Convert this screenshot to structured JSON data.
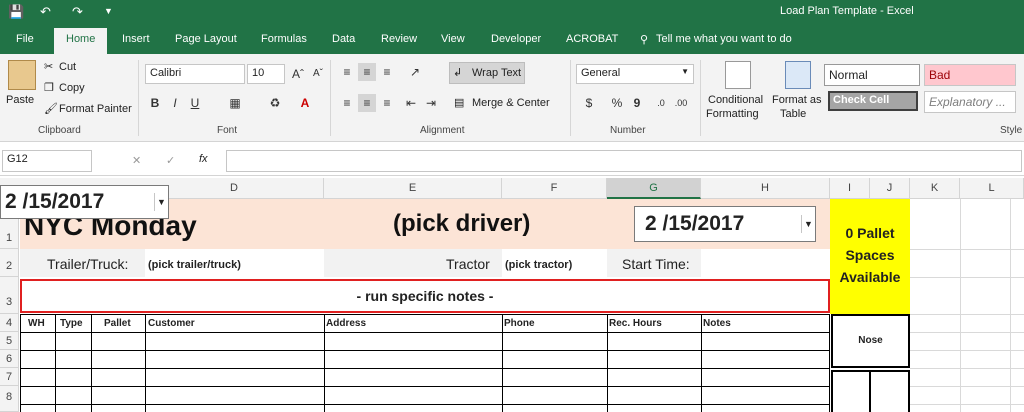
{
  "window": {
    "title": "Load Plan Template  -  Excel"
  },
  "tabs": [
    {
      "label": "File"
    },
    {
      "label": "Home"
    },
    {
      "label": "Insert"
    },
    {
      "label": "Page Layout"
    },
    {
      "label": "Formulas"
    },
    {
      "label": "Data"
    },
    {
      "label": "Review"
    },
    {
      "label": "View"
    },
    {
      "label": "Developer"
    },
    {
      "label": "ACROBAT"
    }
  ],
  "tell_me": "Tell me what you want to do",
  "ribbon": {
    "clipboard": {
      "paste": "Paste",
      "cut": "Cut",
      "copy": "Copy",
      "format_painter": "Format Painter",
      "label": "Clipboard"
    },
    "font": {
      "name": "Calibri",
      "size": "10",
      "label": "Font"
    },
    "alignment": {
      "wrap_text": "Wrap Text",
      "merge_center": "Merge & Center",
      "label": "Alignment"
    },
    "number": {
      "format": "General",
      "label": "Number",
      "currency": "$",
      "percent": "%",
      "comma": "9"
    },
    "styles": {
      "conditional": "Conditional",
      "formatting": "Formatting",
      "format_as": "Format as",
      "table": "Table",
      "normal": "Normal",
      "bad": "Bad",
      "check_cell": "Check Cell",
      "explanatory": "Explanatory ...",
      "label": "Style"
    }
  },
  "formula_bar": {
    "name_box": "G12",
    "formula": ""
  },
  "columns": [
    "D",
    "E",
    "F",
    "G",
    "H",
    "I",
    "J",
    "K",
    "L"
  ],
  "rows": [
    "1",
    "2",
    "3",
    "4",
    "5",
    "6",
    "7",
    "8"
  ],
  "sheet": {
    "date_dropdown_left": "2 /15/2017",
    "title": "NYC Monday",
    "driver": "(pick driver)",
    "date_dropdown_right": "2 /15/2017",
    "pallet_notice": "0 Pallet Spaces Available",
    "trailer_label": "Trailer/Truck:",
    "trailer_value": "(pick trailer/truck)",
    "tractor_label": "Tractor",
    "tractor_value": "(pick tractor)",
    "start_time_label": "Start Time:",
    "run_notes": "- run specific notes -",
    "headers": [
      "WH",
      "Type",
      "Pallet",
      "Customer",
      "Address",
      "Phone",
      "Rec. Hours",
      "Notes"
    ],
    "nose": "Nose"
  },
  "colors": {
    "excel_green": "#217346",
    "title_bg": "#fce4d6",
    "pallet_bg": "#ffff00",
    "notes_border": "#e02020"
  }
}
